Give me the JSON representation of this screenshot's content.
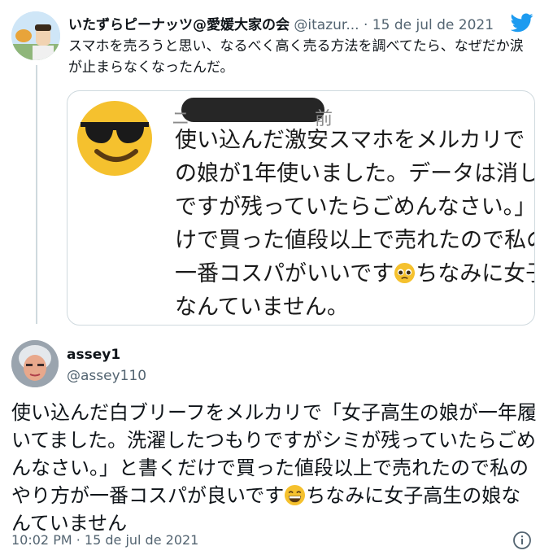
{
  "quoted_tweet": {
    "display_name": "いたずらピーナッツ@愛媛大家の会",
    "handle": "@itazur...",
    "separator": "·",
    "date": "15 de jul de 2021",
    "text": "スマホを売ろうと思い、なるべく高く売る方法を調べてたら、なぜだか涙が止まらなくなったんだ。",
    "screenshot": {
      "prefix": "ニ",
      "suffix": "前",
      "lines": [
        "使い込んだ激安スマホをメルカリで「",
        "の娘が1年使いました。データは消し",
        "ですが残っていたらごめんなさい。」",
        "けで買った値段以上で売れたので私の"
      ],
      "line5_before": "一番コスパがいいです",
      "line5_after": "ちなみに女子",
      "line6": "なんていません。"
    }
  },
  "main_tweet": {
    "display_name": "assey1",
    "handle": "@assey110",
    "body_before_emoji": "使い込んだ白ブリーフをメルカリで「女子高生の娘が一年履いてました。洗濯したつもりですがシミが残っていたらごめんなさい。」と書くだけで買った値段以上で売れたので私のやり方が一番コスパが良いです",
    "body_after_emoji": "ちなみに女子高生の娘なんていません",
    "timestamp": "10:02 PM · 15 de jul de 2021"
  },
  "icons": {
    "brand": "twitter-bird-icon",
    "info": "info-icon",
    "emoji_1": "sunglasses-face-emoji",
    "emoji_2": "pleading-face-emoji",
    "emoji_3": "grinning-face-emoji"
  },
  "colors": {
    "twitter_blue": "#1d9bf0",
    "secondary_text": "#536471",
    "border": "#cfd9de",
    "emoji_yellow": "#f5c12e"
  }
}
